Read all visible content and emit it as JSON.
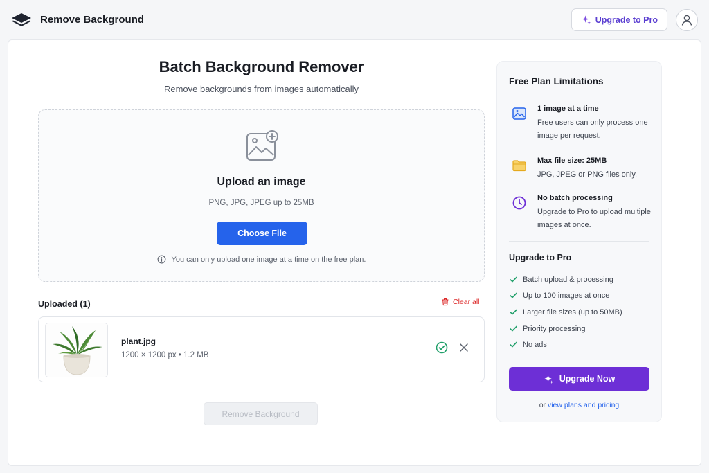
{
  "header": {
    "brand": "Remove Background",
    "upgrade_button": "Upgrade to Pro"
  },
  "main": {
    "title": "Batch Background Remover",
    "subtitle": "Remove backgrounds from images automatically",
    "dropzone": {
      "title": "Upload an image",
      "formats": "PNG, JPG, JPEG up to 25MB",
      "choose_button": "Choose File",
      "note": "You can only upload one image at a time on the free plan."
    },
    "uploaded": {
      "title": "Uploaded (1)",
      "clear_all": "Clear all",
      "files": [
        {
          "name": "plant.jpg",
          "meta": "1200 × 1200 px • 1.2 MB"
        }
      ]
    },
    "remove_button": "Remove Background"
  },
  "sidebar": {
    "title": "Free Plan Limitations",
    "limitations": [
      {
        "title": "1 image at a time",
        "desc": "Free users can only process one image per request.",
        "icon": "image-icon"
      },
      {
        "title": "Max file size: 25MB",
        "desc": "JPG, JPEG or PNG files only.",
        "icon": "folder-icon"
      },
      {
        "title": "No batch processing",
        "desc": "Upgrade to Pro to upload multiple images at once.",
        "icon": "clock-icon"
      }
    ],
    "pro_title": "Upgrade to Pro",
    "features": [
      "Batch upload & processing",
      "Up to 100 images at once",
      "Larger file sizes (up to 50MB)",
      "Priority processing",
      "No ads"
    ],
    "upgrade_now": "Upgrade Now",
    "pricing_prefix": "or",
    "pricing_link": "view plans and pricing"
  },
  "colors": {
    "primary_blue": "#2563eb",
    "purple": "#6d2fd6",
    "success_green": "#22a06b",
    "danger_red": "#dc2626"
  }
}
